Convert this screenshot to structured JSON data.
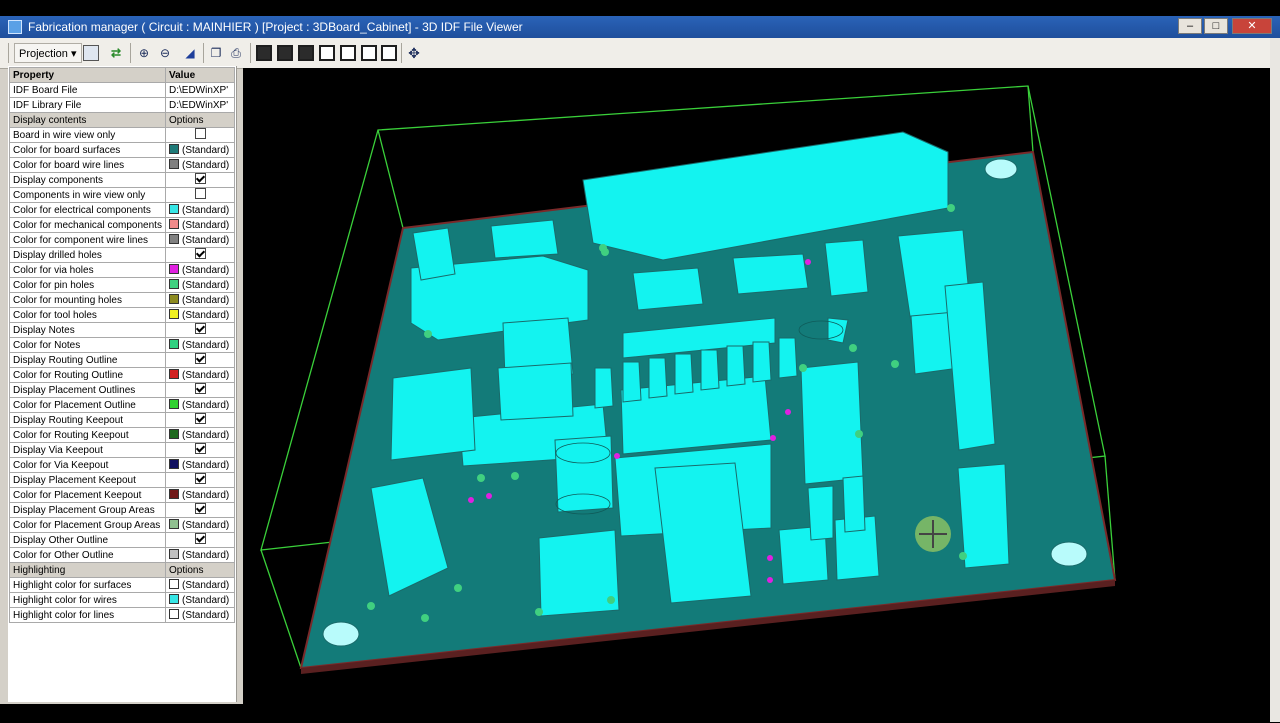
{
  "window": {
    "title": "Fabrication manager ( Circuit : MAINHIER ) [Project : 3DBoard_Cabinet] - 3D IDF File Viewer",
    "min_label": "–",
    "max_label": "□",
    "close_label": "✕"
  },
  "toolbar": {
    "projection_label": "Projection ▾"
  },
  "properties": {
    "header": {
      "property": "Property",
      "value": "Value"
    },
    "rows": [
      {
        "label": "IDF Board File",
        "value": "D:\\EDWinXP'"
      },
      {
        "label": "IDF Library File",
        "value": "D:\\EDWinXP'"
      },
      {
        "label": "Display contents",
        "value": "Options",
        "section": true
      },
      {
        "label": "Board in wire view only",
        "check": false
      },
      {
        "label": "Color for board surfaces",
        "value": "(Standard)",
        "color": "#1e7a78"
      },
      {
        "label": "Color for board wire lines",
        "value": "(Standard)",
        "color": "#808080"
      },
      {
        "label": "Display components",
        "check": true
      },
      {
        "label": "Components in wire view only",
        "check": false
      },
      {
        "label": "Color for electrical components",
        "value": "(Standard)",
        "color": "#36e6e6"
      },
      {
        "label": "Color for mechanical components",
        "value": "(Standard)",
        "color": "#f08a8a"
      },
      {
        "label": "Color for component wire lines",
        "value": "(Standard)",
        "color": "#808080"
      },
      {
        "label": "Display drilled holes",
        "check": true
      },
      {
        "label": "Color for via holes",
        "value": "(Standard)",
        "color": "#e020e0"
      },
      {
        "label": "Color for pin holes",
        "value": "(Standard)",
        "color": "#40d080"
      },
      {
        "label": "Color for mounting holes",
        "value": "(Standard)",
        "color": "#8c8a20"
      },
      {
        "label": "Color for tool holes",
        "value": "(Standard)",
        "color": "#f0f020"
      },
      {
        "label": "Display Notes",
        "check": true
      },
      {
        "label": "Color for Notes",
        "value": "(Standard)",
        "color": "#30d080"
      },
      {
        "label": "Display Routing Outline",
        "check": true
      },
      {
        "label": "Color for Routing Outline",
        "value": "(Standard)",
        "color": "#d02020"
      },
      {
        "label": "Display Placement Outlines",
        "check": true
      },
      {
        "label": "Color for Placement Outline",
        "value": "(Standard)",
        "color": "#30d030"
      },
      {
        "label": "Display Routing Keepout",
        "check": true
      },
      {
        "label": "Color for Routing Keepout",
        "value": "(Standard)",
        "color": "#1f6a1f"
      },
      {
        "label": "Display Via Keepout",
        "check": true
      },
      {
        "label": "Color for Via Keepout",
        "value": "(Standard)",
        "color": "#101060"
      },
      {
        "label": "Display Placement Keepout",
        "check": true
      },
      {
        "label": "Color for Placement Keepout",
        "value": "(Standard)",
        "color": "#701818"
      },
      {
        "label": "Display Placement Group Areas",
        "check": true
      },
      {
        "label": "Color for Placement Group Areas",
        "value": "(Standard)",
        "color": "#90c090"
      },
      {
        "label": "Display Other Outline",
        "check": true
      },
      {
        "label": "Color for Other Outline",
        "value": "(Standard)",
        "color": "#c0c0c0"
      },
      {
        "label": "Highlighting",
        "value": "Options",
        "section": true
      },
      {
        "label": "Highlight color for surfaces",
        "value": "(Standard)",
        "color": "#ffffff"
      },
      {
        "label": "Highlight color for wires",
        "value": "(Standard)",
        "color": "#36e6e6"
      },
      {
        "label": "Highlight color for lines",
        "value": "(Standard)",
        "color": "#ffffff"
      }
    ]
  },
  "viewport": {
    "board_color": "#137b79",
    "component_color": "#13f3f0",
    "outline_color": "#3ad03a",
    "via_color": "#e020e0",
    "pin_color": "#40d080"
  }
}
